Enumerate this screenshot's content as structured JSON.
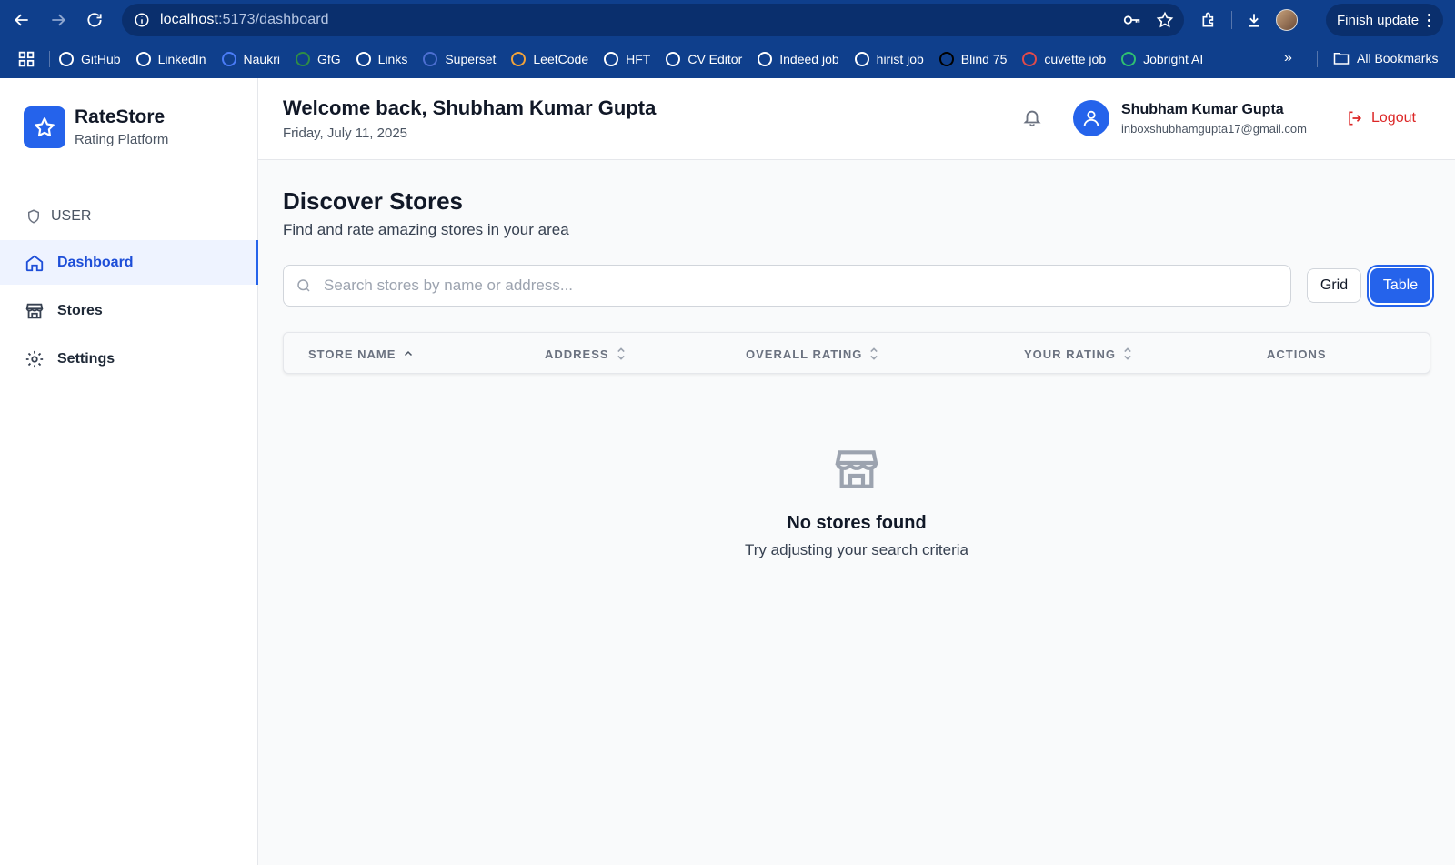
{
  "browser": {
    "url_host": "localhost",
    "url_path": ":5173/dashboard",
    "finish_update": "Finish update",
    "bookmarks": [
      {
        "label": "GitHub",
        "color": "#ffffff",
        "icon": "github-icon"
      },
      {
        "label": "LinkedIn",
        "color": "#ffffff",
        "icon": "linkedin-icon"
      },
      {
        "label": "Naukri",
        "color": "#4a7cf7",
        "icon": "naukri-icon"
      },
      {
        "label": "GfG",
        "color": "#2f8d46",
        "icon": "gfg-icon"
      },
      {
        "label": "Links",
        "color": "#ffffff",
        "icon": "globe-icon"
      },
      {
        "label": "Superset",
        "color": "#4d6fd1",
        "icon": "superset-icon"
      },
      {
        "label": "LeetCode",
        "color": "#f0a23b",
        "icon": "leetcode-icon"
      },
      {
        "label": "HFT",
        "color": "#ffffff",
        "icon": "github-icon"
      },
      {
        "label": "CV Editor",
        "color": "#ffffff",
        "icon": "cv-editor-icon"
      },
      {
        "label": "Indeed job",
        "color": "#ffffff",
        "icon": "info-icon"
      },
      {
        "label": "hirist job",
        "color": "#ffffff",
        "icon": "hirist-icon"
      },
      {
        "label": "Blind 75",
        "color": "#000000",
        "icon": "blind-icon"
      },
      {
        "label": "cuvette job",
        "color": "#e04b4b",
        "icon": "cuvette-icon"
      },
      {
        "label": "Jobright AI",
        "color": "#2fbf71",
        "icon": "jobright-icon"
      }
    ],
    "all_bookmarks": "All Bookmarks"
  },
  "brand": {
    "title": "RateStore",
    "subtitle": "Rating Platform"
  },
  "sidebar": {
    "role": "USER",
    "items": [
      {
        "label": "Dashboard",
        "active": true
      },
      {
        "label": "Stores",
        "active": false
      },
      {
        "label": "Settings",
        "active": false
      }
    ]
  },
  "header": {
    "welcome": "Welcome back, Shubham Kumar Gupta",
    "date": "Friday, July 11, 2025",
    "user_name": "Shubham Kumar Gupta",
    "user_email": "inboxshubhamgupta17@gmail.com",
    "logout": "Logout"
  },
  "main": {
    "title": "Discover Stores",
    "subtitle": "Find and rate amazing stores in your area",
    "search_placeholder": "Search stores by name or address...",
    "search_value": "",
    "view_grid": "Grid",
    "view_table": "Table",
    "active_view": "Table",
    "columns": [
      "STORE NAME",
      "ADDRESS",
      "OVERALL RATING",
      "YOUR RATING",
      "ACTIONS"
    ],
    "sorted_column": "STORE NAME",
    "sort_direction": "asc",
    "empty_title": "No stores found",
    "empty_desc": "Try adjusting your search criteria"
  },
  "colors": {
    "chrome": "#0f3f8c",
    "accent": "#2563eb",
    "danger": "#dc2626"
  }
}
